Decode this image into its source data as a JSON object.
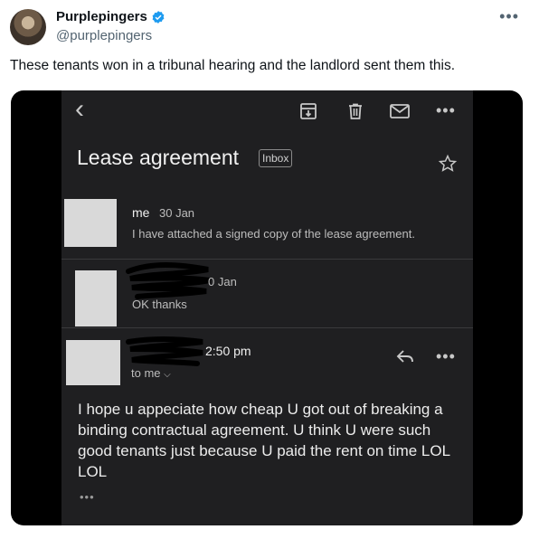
{
  "tweet": {
    "author_name": "Purplepingers",
    "handle": "@purplepingers",
    "more_icon": "more-horizontal-icon",
    "text": "These tenants won in a tribunal hearing and the landlord sent them this."
  },
  "email": {
    "toolbar": {
      "back_icon": "chevron-left-icon",
      "icons": [
        "archive-icon",
        "trash-icon",
        "mail-icon",
        "more-horizontal-icon"
      ]
    },
    "subject": "Lease agreement",
    "label": "Inbox",
    "star_icon": "star-icon",
    "messages": [
      {
        "sender": "me",
        "date": "30 Jan",
        "snippet": "I have attached a signed copy of the lease agreement."
      },
      {
        "date_visible": "0 Jan",
        "snippet": "OK thanks"
      },
      {
        "time": "2:50 pm",
        "recipient": "to me",
        "reply_icon": "reply-icon",
        "more_icon": "more-horizontal-icon",
        "body": "I hope u appeciate how cheap U got out of breaking a binding contractual agreement. U think U were such good tenants just because U paid the rent on time LOL LOL"
      }
    ],
    "expand_dots": "•••"
  },
  "colors": {
    "verified": "#1d9bf0",
    "phone_bg": "#1f1f21",
    "media_bg": "#000000"
  }
}
